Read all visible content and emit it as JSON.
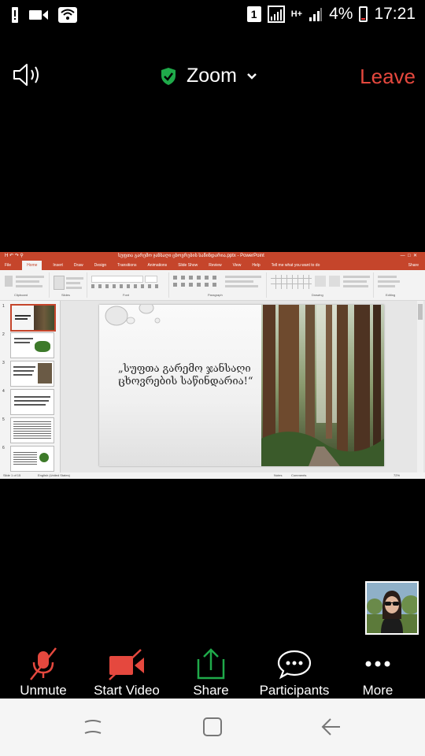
{
  "status_bar": {
    "sim_slot": "1",
    "network_type": "H+",
    "battery_percent": "4%",
    "time": "17:21",
    "icons": [
      "alert-icon",
      "video-notification-icon",
      "wifi-icon",
      "sim-icon",
      "signal-icon",
      "data-icon",
      "signal-icon-2",
      "battery-icon"
    ]
  },
  "header": {
    "speaker_icon": "speaker-icon",
    "security_icon": "shield-check-icon",
    "title": "Zoom",
    "leave_label": "Leave",
    "leave_color": "#e5483e",
    "shield_color": "#1faa4a"
  },
  "shared_screen": {
    "window_title": "სუფთა გარემო ჯანსაღი ცხოვრების საწინდარია.pptx - PowerPoint",
    "ribbon_tabs": [
      "File",
      "Home",
      "Insert",
      "Draw",
      "Design",
      "Transitions",
      "Animations",
      "Slide Show",
      "Review",
      "View",
      "Help",
      "Tell me what you want to do"
    ],
    "active_tab": "Home",
    "share_label": "Share",
    "ribbon_groups": [
      "Clipboard",
      "Slides",
      "Font",
      "Paragraph",
      "Drawing",
      "Editing"
    ],
    "slide_text": "„სუფთა გარემო ჯანსაღი ცხოვრების საწინდარია!“",
    "slide_numbers": [
      "1",
      "2",
      "3",
      "4",
      "5",
      "6"
    ],
    "status_left": "Slide 1 of 15",
    "status_lang": "English (United States)",
    "status_notes": "Notes",
    "status_comments": "Comments",
    "zoom_level": "72%",
    "accent_color": "#c5452b"
  },
  "toolbar": {
    "unmute_label": "Unmute",
    "start_video_label": "Start Video",
    "share_label": "Share",
    "participants_label": "Participants",
    "more_label": "More",
    "muted_color": "#e5483e",
    "share_color": "#1faa4a"
  },
  "nav_bar": {
    "buttons": [
      "recents-icon",
      "home-icon",
      "back-icon"
    ]
  }
}
